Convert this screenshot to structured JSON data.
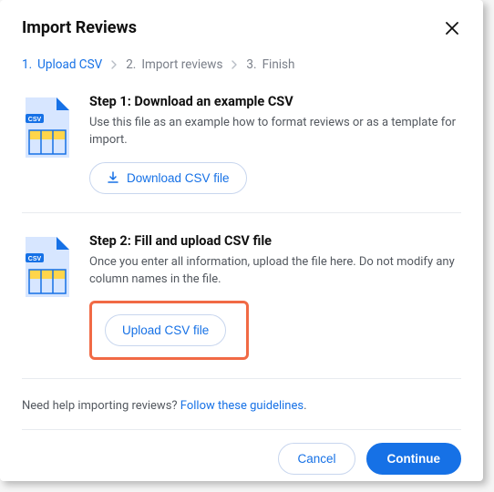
{
  "modal": {
    "title": "Import Reviews"
  },
  "stepper": {
    "steps": [
      {
        "num": "1.",
        "label": "Upload CSV",
        "active": true
      },
      {
        "num": "2.",
        "label": "Import reviews",
        "active": false
      },
      {
        "num": "3.",
        "label": "Finish",
        "active": false
      }
    ]
  },
  "step1": {
    "title": "Step 1: Download an example CSV",
    "desc": "Use this file as an example how to format reviews or as a template for import.",
    "button": "Download CSV file"
  },
  "step2": {
    "title": "Step 2: Fill and upload CSV file",
    "desc": "Once you enter all information, upload the file here. Do not modify any column names in the file.",
    "button": "Upload CSV file"
  },
  "help": {
    "prefix": "Need help importing reviews? ",
    "link": "Follow these guidelines"
  },
  "footer": {
    "cancel": "Cancel",
    "continue": "Continue"
  }
}
